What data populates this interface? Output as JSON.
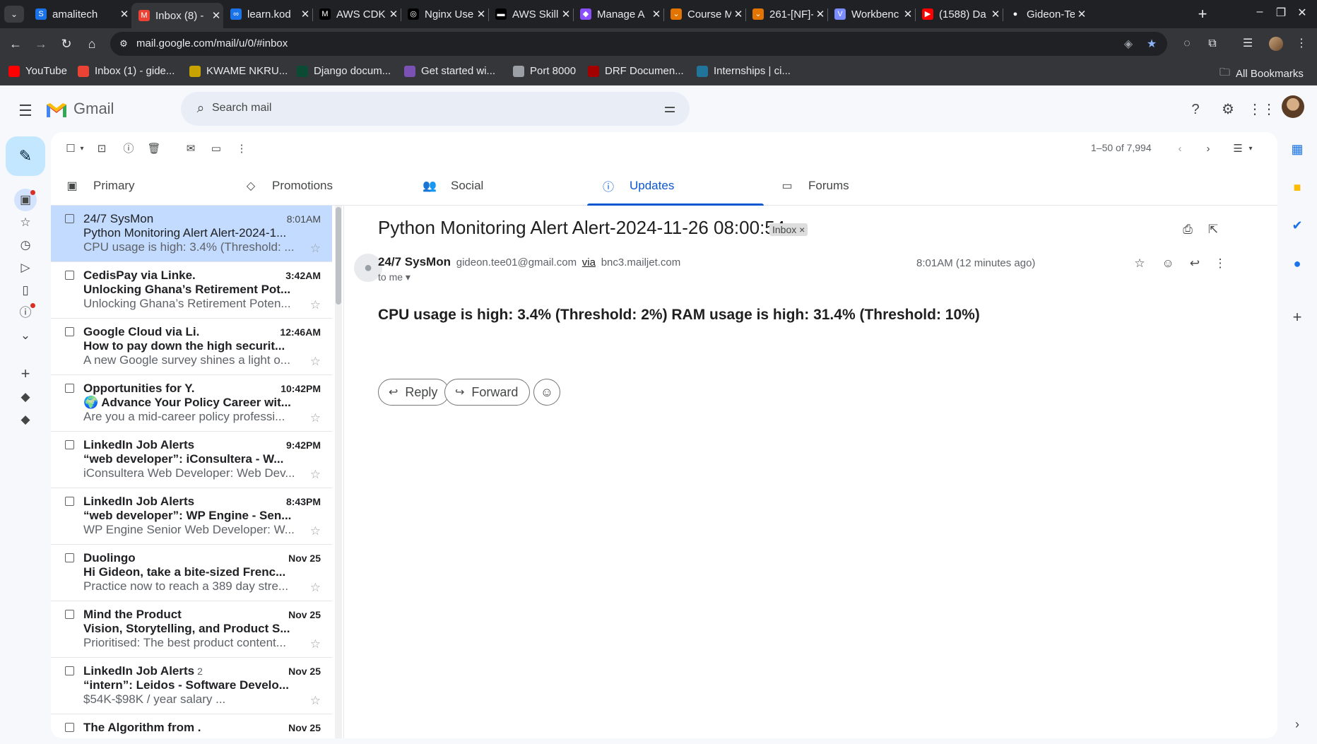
{
  "browser": {
    "tabs": [
      {
        "label": "amalitech",
        "fav_color": "#1a73e8",
        "fav_glyph": "S"
      },
      {
        "label": "Inbox (8) -",
        "fav_color": "#ea4335",
        "fav_glyph": "M"
      },
      {
        "label": "learn.kod",
        "fav_color": "#1a73e8",
        "fav_glyph": "∞"
      },
      {
        "label": "AWS CDK",
        "fav_color": "#000000",
        "fav_glyph": "M"
      },
      {
        "label": "Nginx Use",
        "fav_color": "#000000",
        "fav_glyph": "◎"
      },
      {
        "label": "AWS Skill",
        "fav_color": "#000000",
        "fav_glyph": "▬"
      },
      {
        "label": "Manage A",
        "fav_color": "#8a4fff",
        "fav_glyph": "◆"
      },
      {
        "label": "Course M",
        "fav_color": "#e37400",
        "fav_glyph": "⌄"
      },
      {
        "label": "261-[NF]-",
        "fav_color": "#e37400",
        "fav_glyph": "⌄"
      },
      {
        "label": "Workbenc",
        "fav_color": "#7b8cff",
        "fav_glyph": "V"
      },
      {
        "label": "(1588) Da",
        "fav_color": "#ff0000",
        "fav_glyph": "▶"
      },
      {
        "label": "Gideon-Te",
        "fav_color": "#202124",
        "fav_glyph": "●"
      }
    ],
    "url": "mail.google.com/mail/u/0/#inbox",
    "bookmarks": [
      {
        "label": "YouTube",
        "color": "#ff0000"
      },
      {
        "label": "Inbox (1) - gide...",
        "color": "#ea4335"
      },
      {
        "label": "KWAME NKRU...",
        "color": "#c8a300"
      },
      {
        "label": "Django docum...",
        "color": "#0c4b33"
      },
      {
        "label": "Get started wi...",
        "color": "#7952b3"
      },
      {
        "label": "Port 8000",
        "color": "#9aa0a6"
      },
      {
        "label": "DRF Documen...",
        "color": "#a30000"
      },
      {
        "label": "Internships | ci...",
        "color": "#21759b"
      }
    ],
    "all_bookmarks": "All Bookmarks"
  },
  "gmail": {
    "wordmark": "Gmail",
    "search_placeholder": "Search mail",
    "pager": "1–50 of 7,994",
    "tabs": [
      {
        "label": "Primary",
        "icon": "inbox-icon"
      },
      {
        "label": "Promotions",
        "icon": "tag-icon"
      },
      {
        "label": "Social",
        "icon": "people-icon"
      },
      {
        "label": "Updates",
        "icon": "info-icon"
      },
      {
        "label": "Forums",
        "icon": "forum-icon"
      }
    ],
    "active_tab": "Updates",
    "accent": "#0b57d0",
    "emails": [
      {
        "sender": "24/7 SysMon",
        "date": "8:01AM",
        "subject": "Python Monitoring Alert Alert-2024-1...",
        "snippet": "CPU usage is high: 3.4% (Threshold: ...",
        "unread": false,
        "selected": true
      },
      {
        "sender": "CedisPay via Linke.",
        "date": "3:42AM",
        "subject": "Unlocking Ghana’s Retirement Pot...",
        "snippet": "Unlocking Ghana’s Retirement Poten...",
        "unread": true
      },
      {
        "sender": "Google Cloud via Li.",
        "date": "12:46AM",
        "subject": "How to pay down the high securit...",
        "snippet": "A new Google survey shines a light o...",
        "unread": true
      },
      {
        "sender": "Opportunities for Y.",
        "date": "10:42PM",
        "subject": "🌍 Advance Your Policy Career wit...",
        "snippet": "Are you a mid-career policy professi...",
        "unread": true
      },
      {
        "sender": "LinkedIn Job Alerts",
        "date": "9:42PM",
        "subject": "“web developer”: iConsultera - W...",
        "snippet": "iConsultera Web Developer: Web Dev...",
        "unread": true
      },
      {
        "sender": "LinkedIn Job Alerts",
        "date": "8:43PM",
        "subject": "“web developer”: WP Engine - Sen...",
        "snippet": "WP Engine Senior Web Developer: W...",
        "unread": true
      },
      {
        "sender": "Duolingo",
        "date": "Nov 25",
        "subject": "Hi Gideon, take a bite-sized Frenc...",
        "snippet": "Practice now to reach a 389 day stre...",
        "unread": true
      },
      {
        "sender": "Mind the Product",
        "date": "Nov 25",
        "subject": "Vision, Storytelling, and Product S...",
        "snippet": "Prioritised: The best product content...",
        "unread": true
      },
      {
        "sender": "LinkedIn Job Alerts",
        "count": "2",
        "date": "Nov 25",
        "subject": "“intern”: Leidos - Software Develo...",
        "snippet": "$54K-$98K / year salary          ...",
        "unread": true
      },
      {
        "sender": "The Algorithm from .",
        "date": "Nov 25",
        "subject": "",
        "snippet": "",
        "unread": true
      }
    ],
    "reader": {
      "subject": "Python Monitoring Alert Alert-2024-11-26 08:00:54",
      "label": "Inbox ×",
      "from_name": "24/7 SysMon",
      "from_addr": "gideon.tee01@gmail.com",
      "via_label": "via",
      "via_domain": "bnc3.mailjet.com",
      "to": "to me ▾",
      "time": "8:01AM (12 minutes ago)",
      "body": "CPU usage is high: 3.4% (Threshold: 2%) RAM usage is high: 31.4% (Threshold: 10%)",
      "reply_label": "Reply",
      "forward_label": "Forward"
    }
  }
}
